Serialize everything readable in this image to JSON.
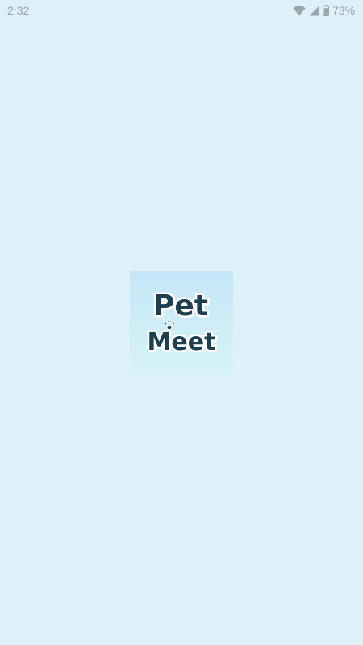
{
  "status_bar": {
    "time": "2:32",
    "battery_percent": "73%",
    "icons": [
      "wifi-icon",
      "cellular-signal-icon",
      "battery-icon"
    ]
  },
  "splash": {
    "logo_line1": "Pet",
    "logo_line2": "Meet",
    "logo_icon": "paw-print-icon"
  },
  "colors": {
    "background": "#dff1f8",
    "logo_text": "#1d3f4e",
    "status_text": "#9aa6ab"
  }
}
